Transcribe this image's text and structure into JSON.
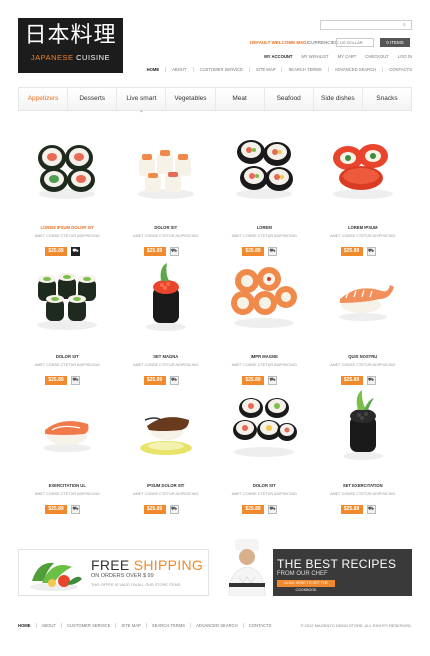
{
  "logo": {
    "kanji": "日本料理",
    "word1": "JAPANESE",
    "word2": "CUISINE"
  },
  "search": {
    "placeholder": ""
  },
  "header": {
    "welcome": "DEFAULT WELCOME MSG!",
    "currency_label": "CURRENCIES:",
    "currency_value": "US DOLLAR",
    "cart_label": "0 ITEMS"
  },
  "account_links": [
    "MY ACCOUNT",
    "MY WISHLIST",
    "MY CART",
    "CHECKOUT",
    "LOG IN"
  ],
  "top_nav": [
    "HOME",
    "ABOUT",
    "CUSTOMER SERVICE",
    "SITE MAP",
    "SEARCH TERMS",
    "ADVANCED SEARCH",
    "CONTACTS"
  ],
  "categories": [
    "Appetizers",
    "Desserts",
    "Live smart",
    "Vegetables",
    "Meat",
    "Seafood",
    "Side dishes",
    "Snacks"
  ],
  "products": [
    {
      "name": "LOREM IPSUM DOLOR SIT",
      "desc": "AMET CONSE CTETUR ADIPISICING",
      "price": "$25.89"
    },
    {
      "name": "DOLOR SIT",
      "desc": "AMET CONSE CTETUR ADIPISICING",
      "price": "$25.89"
    },
    {
      "name": "LOREM",
      "desc": "AMET CONSE CTETUR ADIPISICING",
      "price": "$25.89"
    },
    {
      "name": "LOREM IPSUM",
      "desc": "AMET CONSE CTETUR ADIPISICING",
      "price": "$25.89"
    },
    {
      "name": "DOLOR SIT",
      "desc": "AMET CONSE CTETUR ADIPISICING",
      "price": "$25.89"
    },
    {
      "name": "SET MAGNA",
      "desc": "AMET CONSE CTETUR ADIPISICING",
      "price": "$25.89"
    },
    {
      "name": "IMPR MAGNE",
      "desc": "AMET CONSE CTETUR ADIPISICING",
      "price": "$25.89"
    },
    {
      "name": "QUIS NOSTRU",
      "desc": "AMET CONSE CTETUR ADIPISICING",
      "price": "$25.89"
    },
    {
      "name": "EXERCITATION UL",
      "desc": "AMET CONSE CTETUR ADIPISICING",
      "price": "$25.89"
    },
    {
      "name": "IPSUM DOLOR SIT",
      "desc": "AMET CONSE CTETUR ADIPISICING",
      "price": "$25.89"
    },
    {
      "name": "DOLOR SIT",
      "desc": "AMET CONSE CTETUR ADIPISICING",
      "price": "$25.89"
    },
    {
      "name": "SET EXERCITATION",
      "desc": "AMET CONSE CTETUR ADIPISICING",
      "price": "$25.89"
    }
  ],
  "banner_shipping": {
    "word1": "FREE",
    "word2": "SHIPPING",
    "line2": "ON ORDERS OVER $ 99",
    "line3": "THIS OFFER IS VALID ON ALL OUR STORE ITEMS."
  },
  "banner_recipes": {
    "line1": "THE BEST RECIPES",
    "line2": "FROM OUR CHEF",
    "button": "CLICK HERE TO GET THE COOKBOOK"
  },
  "footer_nav": [
    "HOME",
    "ABOUT",
    "CUSTOMER SERVICE",
    "SITE MAP",
    "SEARCH TERMS",
    "ADVANCED SEARCH",
    "CONTACTS"
  ],
  "copyright": "© 2012 MAGENTO DEMO STORE. ALL RIGHTS RESERVED.",
  "colors": {
    "accent": "#f08a2c",
    "dark": "#1c1c1c"
  }
}
